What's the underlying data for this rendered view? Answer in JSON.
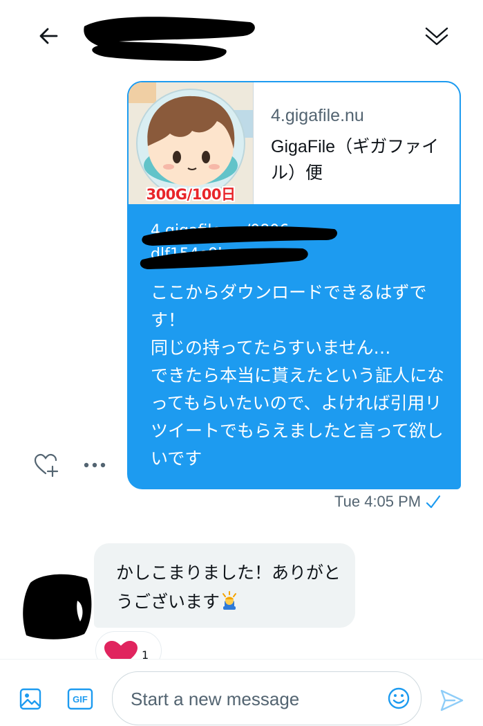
{
  "colors": {
    "accent": "#1d9bf0",
    "muted": "#536471",
    "incoming_bg": "#eff3f4",
    "like_red": "#e0245e"
  },
  "header": {
    "back_icon": "arrow-left-icon",
    "collapse_icon": "double-chevron-down-icon"
  },
  "outgoing": {
    "card": {
      "image_caption": "300G/100日",
      "domain": "4.gigafile.nu",
      "title": "GigaFile（ギガファイル）便"
    },
    "link_line1": "4.gigafile.nu/0806",
    "link_line2": "dlf154e9b",
    "body": "ここからダウンロードできるはずです！\n同じの持ってたらすいません…\nできたら本当に貰えたという証人になってもらいたいので、よければ引用リツイートでもらえましたと言って欲しいです",
    "timestamp": "Tue 4:05 PM",
    "actions": {
      "react_icon": "heart-plus-icon",
      "more_icon": "more-horizontal-icon"
    }
  },
  "incoming": {
    "text_before_emoji": "かしこまりました！ありがとうございます",
    "emoji": "person-bowing-icon",
    "reaction": {
      "icon": "heart-icon",
      "count": "1"
    }
  },
  "composer": {
    "placeholder": "Start a new message",
    "value": "",
    "image_icon": "image-icon",
    "gif_label": "GIF",
    "emoji_icon": "emoji-icon",
    "send_icon": "send-icon"
  }
}
